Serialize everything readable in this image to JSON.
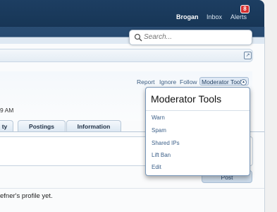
{
  "header": {
    "username": "Brogan",
    "inbox_label": "Inbox",
    "alerts_label": "Alerts",
    "alerts_count": "8"
  },
  "search": {
    "placeholder": "Search..."
  },
  "profile": {
    "actions": {
      "report": "Report",
      "ignore": "Ignore",
      "follow": "Follow",
      "moderator_tools": "Moderator Tools"
    },
    "time_fragment": "9 AM",
    "tabs": [
      {
        "label": "ty"
      },
      {
        "label": "Postings"
      },
      {
        "label": "Information"
      }
    ],
    "post_button": "Post",
    "empty_message": "efner's profile yet."
  },
  "moderator_menu": {
    "title": "Moderator Tools",
    "items": [
      "Warn",
      "Spam",
      "Shared IPs",
      "Lift Ban",
      "Edit"
    ]
  },
  "colors": {
    "header_bg": "#1d3e62",
    "badge_bg": "#d53030",
    "link": "#3b5f88"
  }
}
